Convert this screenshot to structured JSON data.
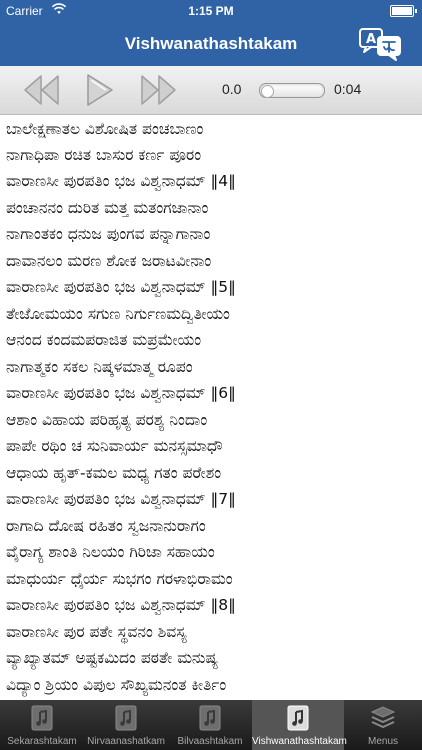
{
  "status": {
    "carrier": "Carrier",
    "time": "1:15 PM"
  },
  "nav": {
    "title": "Vishwanathashtakam"
  },
  "player": {
    "current_time": "0.0",
    "total_time": "0:04"
  },
  "lyrics": [
    "ಬಾಲೇಕ್ಷಣಾತಲ ವಿಶೋಷಿತ ಪಂಚಬಾಣಂ",
    "ನಾಗಾಧಿಪಾ ರಚಿತ ಬಾಸುರ ಕರ್ಣ ಪೂರಂ",
    "ವಾರಾಣಸೀ ಪುರಪತಿಂ ಭಜ ವಿಶ್ವನಾಧಮ್ ‖4‖",
    "ಪಂಚಾನನಂ ದುರಿತ ಮತ್ತ ಮತಂಗಜಾನಾಂ",
    "ನಾಗಾಂತಕಂ ಧನುಜ ಪುಂಗವ ಪನ್ನಾಗಾನಾಂ",
    "ದಾವಾನಲಂ ಮರಣ ಶೋಕ ಜರಾಟವೀನಾಂ",
    "ವಾರಾಣಸೀ ಪುರಪತಿಂ ಭಜ ವಿಶ್ವನಾಧಮ್ ‖5‖",
    "ತೇಜೋಮಯಂ ಸಗುಣ ನಿರ್ಗುಣಮದ್ವಿತೀಯಂ",
    "ಆನಂದ ಕಂದಮಪರಾಜಿತ ಮಪ್ರಮೇಯಂ",
    "ನಾಗಾತ್ಮಕಂ ಸಕಲ ನಿಷ್ಕಳಮಾತ್ಮ ರೂಪಂ",
    "ವಾರಾಣಸೀ ಪುರಪತಿಂ ಭಜ ವಿಶ್ವನಾಧಮ್ ‖6‖",
    "ಆಶಾಂ ವಿಹಾಯ ಪರಿಹೃತ್ಯ ಪರಶ್ಯ ನಿಂದಾಂ",
    "ಪಾಪೇ ರಥಿಂ ಚ ಸುನಿವಾರ್ಯ ಮನಸ್ಸಮಾಧೌ",
    "ಆಧಾಯ ಹೃತ್-ಕಮಲ ಮಧ್ಯ ಗತಂ ಪರೇಶಂ",
    "ವಾರಾಣಸೀ ಪುರಪತಿಂ ಭಜ ವಿಶ್ವನಾಧಮ್ ‖7‖",
    "ರಾಗಾದಿ ದೋಷ ರಹಿತಂ ಸ್ವಜನಾನುರಾಗಂ",
    "ವೈರಾಗ್ಯ ಶಾಂತಿ ನಿಲಯಂ ಗಿರಿಜಾ ಸಹಾಯಂ",
    "ಮಾಧುರ್ಯ ಧೈರ್ಯ ಸುಭಗಂ ಗರಳಾಭಿರಾಮಂ",
    "ವಾರಾಣಸೀ ಪುರಪತಿಂ ಭಜ ವಿಶ್ವನಾಧಮ್ ‖8‖",
    "ವಾರಾಣಸೀ ಪುರ ಪತೇ ಸ್ಥವನಂ ಶಿವಸ್ಯ",
    "ವ್ಯಾಖ್ಯಾತಮ್ ಅಷ್ಟಕಮಿದಂ ಪಠತೇ ಮನುಷ್ಯ",
    "ವಿದ್ಯಾಂ ಶ್ರಿಯಂ ವಿಪುಲ ಸೌಖ್ಯಮನಂತ ಕೀರ್ತಿಂ"
  ],
  "tabs": [
    {
      "label": "Sekarashtakam",
      "icon": "song-list-icon"
    },
    {
      "label": "Nirvaanashatkam",
      "icon": "song-list-icon"
    },
    {
      "label": "Bilvaashtakam",
      "icon": "song-list-icon"
    },
    {
      "label": "Vishwanathashtakam",
      "icon": "song-list-icon"
    },
    {
      "label": "Menus",
      "icon": "stack-icon"
    }
  ]
}
